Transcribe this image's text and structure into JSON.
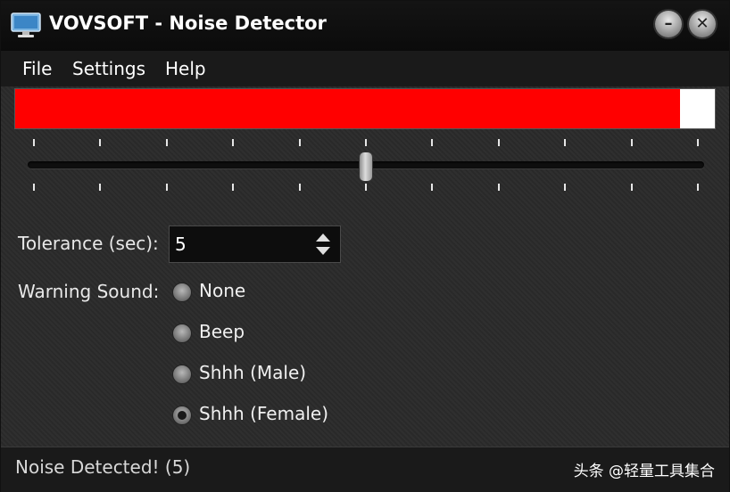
{
  "window": {
    "title": "VOVSOFT - Noise Detector",
    "minimize_glyph": "–",
    "close_glyph": "✕",
    "icon": "monitor-icon"
  },
  "menu": {
    "items": [
      "File",
      "Settings",
      "Help"
    ]
  },
  "noise_level": {
    "fraction": 0.95,
    "fill_color": "#ff0000"
  },
  "threshold_slider": {
    "fraction": 0.5,
    "tick_count": 11
  },
  "tolerance": {
    "label": "Tolerance (sec):",
    "value": "5"
  },
  "warning_sound": {
    "label": "Warning Sound:",
    "options": [
      "None",
      "Beep",
      "Shhh (Male)",
      "Shhh (Female)"
    ],
    "selected": "Shhh (Female)"
  },
  "status": {
    "text": "Noise Detected! (5)"
  },
  "watermark": {
    "text": "头条 @轻量工具集合"
  }
}
